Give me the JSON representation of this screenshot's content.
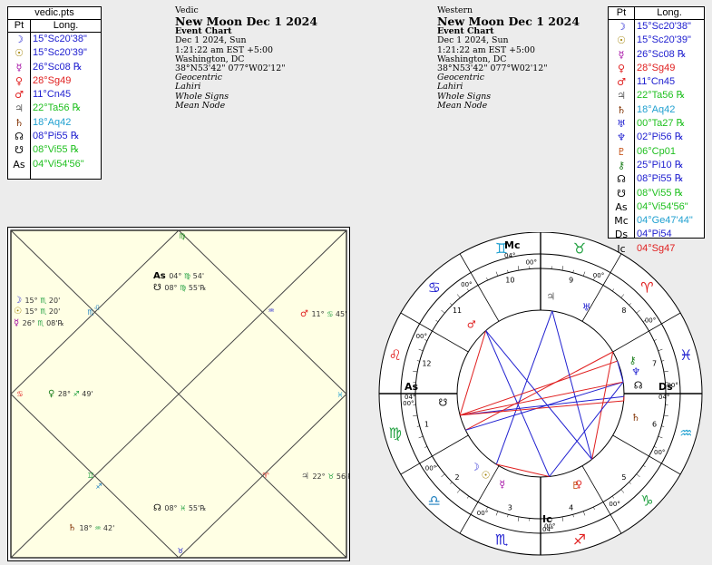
{
  "vedic_table": {
    "title": "vedic.pts",
    "col_pt": "Pt",
    "col_long": "Long.",
    "rows": [
      {
        "glyph": "☽",
        "name": "moon-icon",
        "value": "15°Sc20'38\"",
        "color": "#2020d0",
        "gcolor": "#2020d0"
      },
      {
        "glyph": "☉",
        "name": "sun-icon",
        "value": "15°Sc20'39\"",
        "color": "#2020d0",
        "gcolor": "#a08000"
      },
      {
        "glyph": "☿",
        "name": "mercury-icon",
        "value": "26°Sc08 ℞",
        "color": "#2020d0",
        "gcolor": "#a000a0"
      },
      {
        "glyph": "♀",
        "name": "venus-icon",
        "value": "28°Sg49",
        "color": "#e02020",
        "gcolor": "#e02020"
      },
      {
        "glyph": "♂",
        "name": "mars-icon",
        "value": "11°Cn45",
        "color": "#2020d0",
        "gcolor": "#e02020"
      },
      {
        "glyph": "♃",
        "name": "jupiter-icon",
        "value": "22°Ta56 ℞",
        "color": "#20c020",
        "gcolor": "#606060"
      },
      {
        "glyph": "♄",
        "name": "saturn-icon",
        "value": "18°Aq42",
        "color": "#20a0d0",
        "gcolor": "#803000"
      },
      {
        "glyph": "☊",
        "name": "north-node-icon",
        "value": "08°Pi55 ℞",
        "color": "#2020d0",
        "gcolor": "#000"
      },
      {
        "glyph": "☋",
        "name": "south-node-icon",
        "value": "08°Vi55 ℞",
        "color": "#20c020",
        "gcolor": "#000"
      },
      {
        "glyph": "As",
        "name": "ascendant-icon",
        "value": "04°Vi54'56\"",
        "color": "#20c020",
        "gcolor": "#000"
      }
    ]
  },
  "vedic_info": {
    "label": "Vedic",
    "title": "New Moon Dec 1 2024",
    "chart_type": "Event Chart",
    "date": "Dec 1 2024, Sun",
    "time": "1:21:22 am  EST +5:00",
    "place": "Washington, DC",
    "coords": "38°N53'42\" 077°W02'12\"",
    "opt1": "Geocentric",
    "opt2": "Lahiri",
    "opt3": "Whole Signs",
    "opt4": "Mean Node"
  },
  "western_info": {
    "label": "Western",
    "title": "New Moon Dec 1 2024",
    "chart_type": "Event Chart",
    "date": "Dec 1 2024, Sun",
    "time": "1:21:22 am  EST +5:00",
    "place": "Washington, DC",
    "coords": "38°N53'42\" 077°W02'12\"",
    "opt1": "Geocentric",
    "opt2": "Lahiri",
    "opt3": "Whole Signs",
    "opt4": "Mean Node"
  },
  "western_table": {
    "col_pt": "Pt",
    "col_long": "Long.",
    "rows": [
      {
        "glyph": "☽",
        "name": "moon-icon",
        "value": "15°Sc20'38\"",
        "color": "#2020d0",
        "gcolor": "#2020d0"
      },
      {
        "glyph": "☉",
        "name": "sun-icon",
        "value": "15°Sc20'39\"",
        "color": "#2020d0",
        "gcolor": "#a08000"
      },
      {
        "glyph": "☿",
        "name": "mercury-icon",
        "value": "26°Sc08 ℞",
        "color": "#2020d0",
        "gcolor": "#a000a0"
      },
      {
        "glyph": "♀",
        "name": "venus-icon",
        "value": "28°Sg49",
        "color": "#e02020",
        "gcolor": "#e02020"
      },
      {
        "glyph": "♂",
        "name": "mars-icon",
        "value": "11°Cn45",
        "color": "#2020d0",
        "gcolor": "#e02020"
      },
      {
        "glyph": "♃",
        "name": "jupiter-icon",
        "value": "22°Ta56 ℞",
        "color": "#20c020",
        "gcolor": "#606060"
      },
      {
        "glyph": "♄",
        "name": "saturn-icon",
        "value": "18°Aq42",
        "color": "#20a0d0",
        "gcolor": "#803000"
      },
      {
        "glyph": "♅",
        "name": "uranus-icon",
        "value": "00°Ta27 ℞",
        "color": "#20c020",
        "gcolor": "#2020d0"
      },
      {
        "glyph": "♆",
        "name": "neptune-icon",
        "value": "02°Pi56 ℞",
        "color": "#2020d0",
        "gcolor": "#2020d0"
      },
      {
        "glyph": "♇",
        "name": "pluto-icon",
        "value": "06°Cp01",
        "color": "#20c020",
        "gcolor": "#c04000"
      },
      {
        "glyph": "⚷",
        "name": "chiron-icon",
        "value": "25°Pi10 ℞",
        "color": "#2020d0",
        "gcolor": "#208020"
      },
      {
        "glyph": "☊",
        "name": "north-node-icon",
        "value": "08°Pi55 ℞",
        "color": "#2020d0",
        "gcolor": "#000"
      },
      {
        "glyph": "☋",
        "name": "south-node-icon",
        "value": "08°Vi55 ℞",
        "color": "#20c020",
        "gcolor": "#000"
      },
      {
        "glyph": "As",
        "name": "ascendant-icon",
        "value": "04°Vi54'56\"",
        "color": "#20c020",
        "gcolor": "#000"
      },
      {
        "glyph": "Mc",
        "name": "midheaven-icon",
        "value": "04°Ge47'44\"",
        "color": "#20a0d0",
        "gcolor": "#000"
      },
      {
        "glyph": "Ds",
        "name": "descendant-icon",
        "value": "04°Pi54",
        "color": "#2020d0",
        "gcolor": "#000"
      },
      {
        "glyph": "Ic",
        "name": "imum-coeli-icon",
        "value": "04°Sg47",
        "color": "#e02020",
        "gcolor": "#000"
      }
    ]
  },
  "vedic_chart": {
    "planets": [
      {
        "name": "ascendant-label",
        "glyph": "As",
        "deg": "04°",
        "sign": "♍",
        "min": "54'",
        "color": "#000"
      },
      {
        "name": "south-node-label",
        "glyph": "☋",
        "deg": "08°",
        "sign": "♍",
        "min": "55'℞",
        "color": "#000"
      },
      {
        "name": "moon-label",
        "glyph": "☽",
        "deg": "15°",
        "sign": "♏",
        "min": "20'",
        "color": "#2020d0"
      },
      {
        "name": "sun-label",
        "glyph": "☉",
        "deg": "15°",
        "sign": "♏",
        "min": "20'",
        "color": "#a08000"
      },
      {
        "name": "mercury-label",
        "glyph": "☿",
        "deg": "26°",
        "sign": "♏",
        "min": "08'℞",
        "color": "#a000a0"
      },
      {
        "name": "mars-label",
        "glyph": "♂",
        "deg": "11°",
        "sign": "♋",
        "min": "45'",
        "color": "#e02020"
      },
      {
        "name": "venus-label",
        "glyph": "♀",
        "deg": "28°",
        "sign": "♐",
        "min": "49'",
        "color": "#208020"
      },
      {
        "name": "jupiter-label",
        "glyph": "♃",
        "deg": "22°",
        "sign": "♉",
        "min": "56'℞",
        "color": "#606060"
      },
      {
        "name": "north-node-label",
        "glyph": "☊",
        "deg": "08°",
        "sign": "♓",
        "min": "55'℞",
        "color": "#000"
      },
      {
        "name": "saturn-label",
        "glyph": "♄",
        "deg": "18°",
        "sign": "♒",
        "min": "42'",
        "color": "#803000"
      }
    ],
    "sign_marks": [
      "♍",
      "♌",
      "♋",
      "♊",
      "♉",
      "♈",
      "♓",
      "♒",
      "♑",
      "♐",
      "♏",
      "♎"
    ]
  },
  "western_chart": {
    "cusp_labels": [
      "00°",
      "00°",
      "00°",
      "00°",
      "00°",
      "00°",
      "00°",
      "00°",
      "00°",
      "00°",
      "00°",
      "00°"
    ],
    "house_numbers": [
      "1",
      "2",
      "3",
      "4",
      "5",
      "6",
      "7",
      "8",
      "9",
      "10",
      "11",
      "12"
    ],
    "angle_mc_deg": "04°",
    "angle_mc_min": "47'",
    "angle_ic_deg": "04°",
    "angle_ic_min": "47'",
    "angle_as_deg": "04°",
    "angle_as_min": "54'",
    "angle_ds_deg": "04°",
    "angle_ds_min": "54'"
  }
}
